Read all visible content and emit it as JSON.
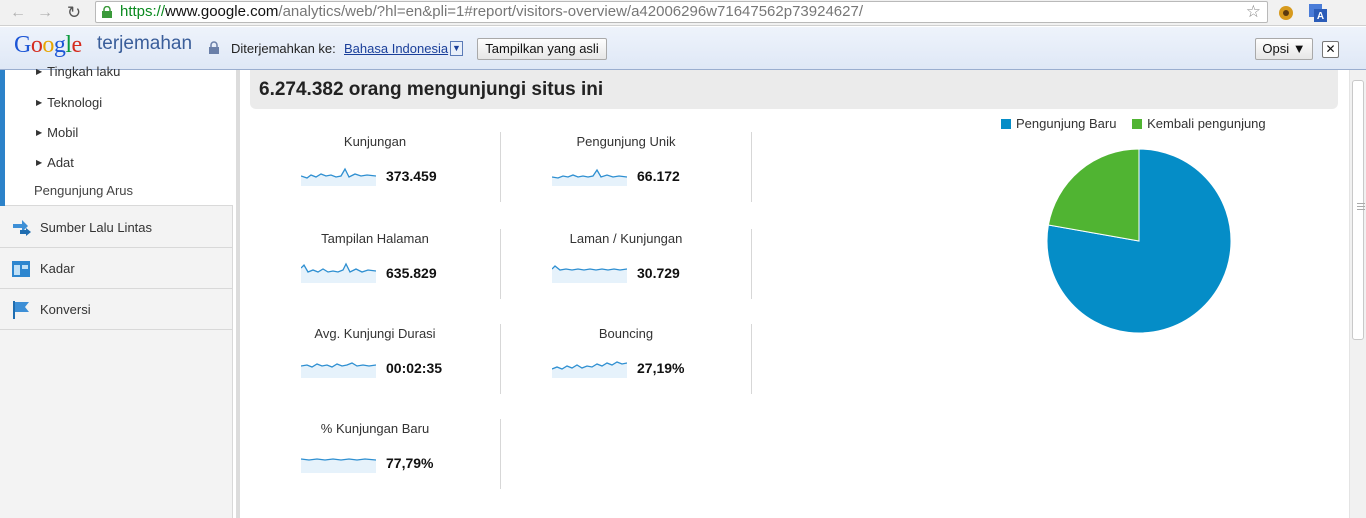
{
  "browser": {
    "url_scheme": "https://",
    "url_host": "www.google.com",
    "url_path": "/analytics/web/?hl=en&pli=1#report/visitors-overview/a42006296w71647562p73924627/"
  },
  "translate_bar": {
    "logo_text": "Google",
    "product": "terjemahan",
    "translated_to_label": "Diterjemahkan ke:",
    "language": "Bahasa Indonesia",
    "show_original_button": "Tampilkan yang asli",
    "options_button": "Opsi ▼",
    "close_glyph": "✕"
  },
  "sidebar": {
    "sub_items": [
      "Tingkah laku",
      "Teknologi",
      "Mobil",
      "Adat"
    ],
    "flow_item": "Pengunjung Arus",
    "items": [
      {
        "label": "Sumber Lalu Lintas",
        "icon": "traffic-sources-icon"
      },
      {
        "label": "Kadar",
        "icon": "content-icon"
      },
      {
        "label": "Konversi",
        "icon": "conversions-flag-icon"
      }
    ]
  },
  "main": {
    "title": "6.274.382 orang mengunjungi situs ini",
    "metrics": [
      {
        "name": "Kunjungan",
        "value": "373.459"
      },
      {
        "name": "Pengunjung Unik",
        "value": "66.172"
      },
      {
        "name": "Tampilan Halaman",
        "value": "635.829"
      },
      {
        "name": "Laman / Kunjungan",
        "value": "30.729"
      },
      {
        "name": "Avg. Kunjungi Durasi",
        "value": "00:02:35"
      },
      {
        "name": "Bouncing",
        "value": "27,19%"
      },
      {
        "name": "% Kunjungan Baru",
        "value": "77,79%"
      }
    ],
    "legend": [
      {
        "name": "Pengunjung Baru",
        "color": "#058dc7"
      },
      {
        "name": "Kembali pengunjung",
        "color": "#50b432"
      }
    ]
  },
  "chart_data": {
    "type": "pie",
    "categories": [
      "Pengunjung Baru",
      "Kembali pengunjung"
    ],
    "values": [
      77.79,
      22.21
    ],
    "colors": [
      "#058dc7",
      "#50b432"
    ],
    "legend_position": "top"
  }
}
